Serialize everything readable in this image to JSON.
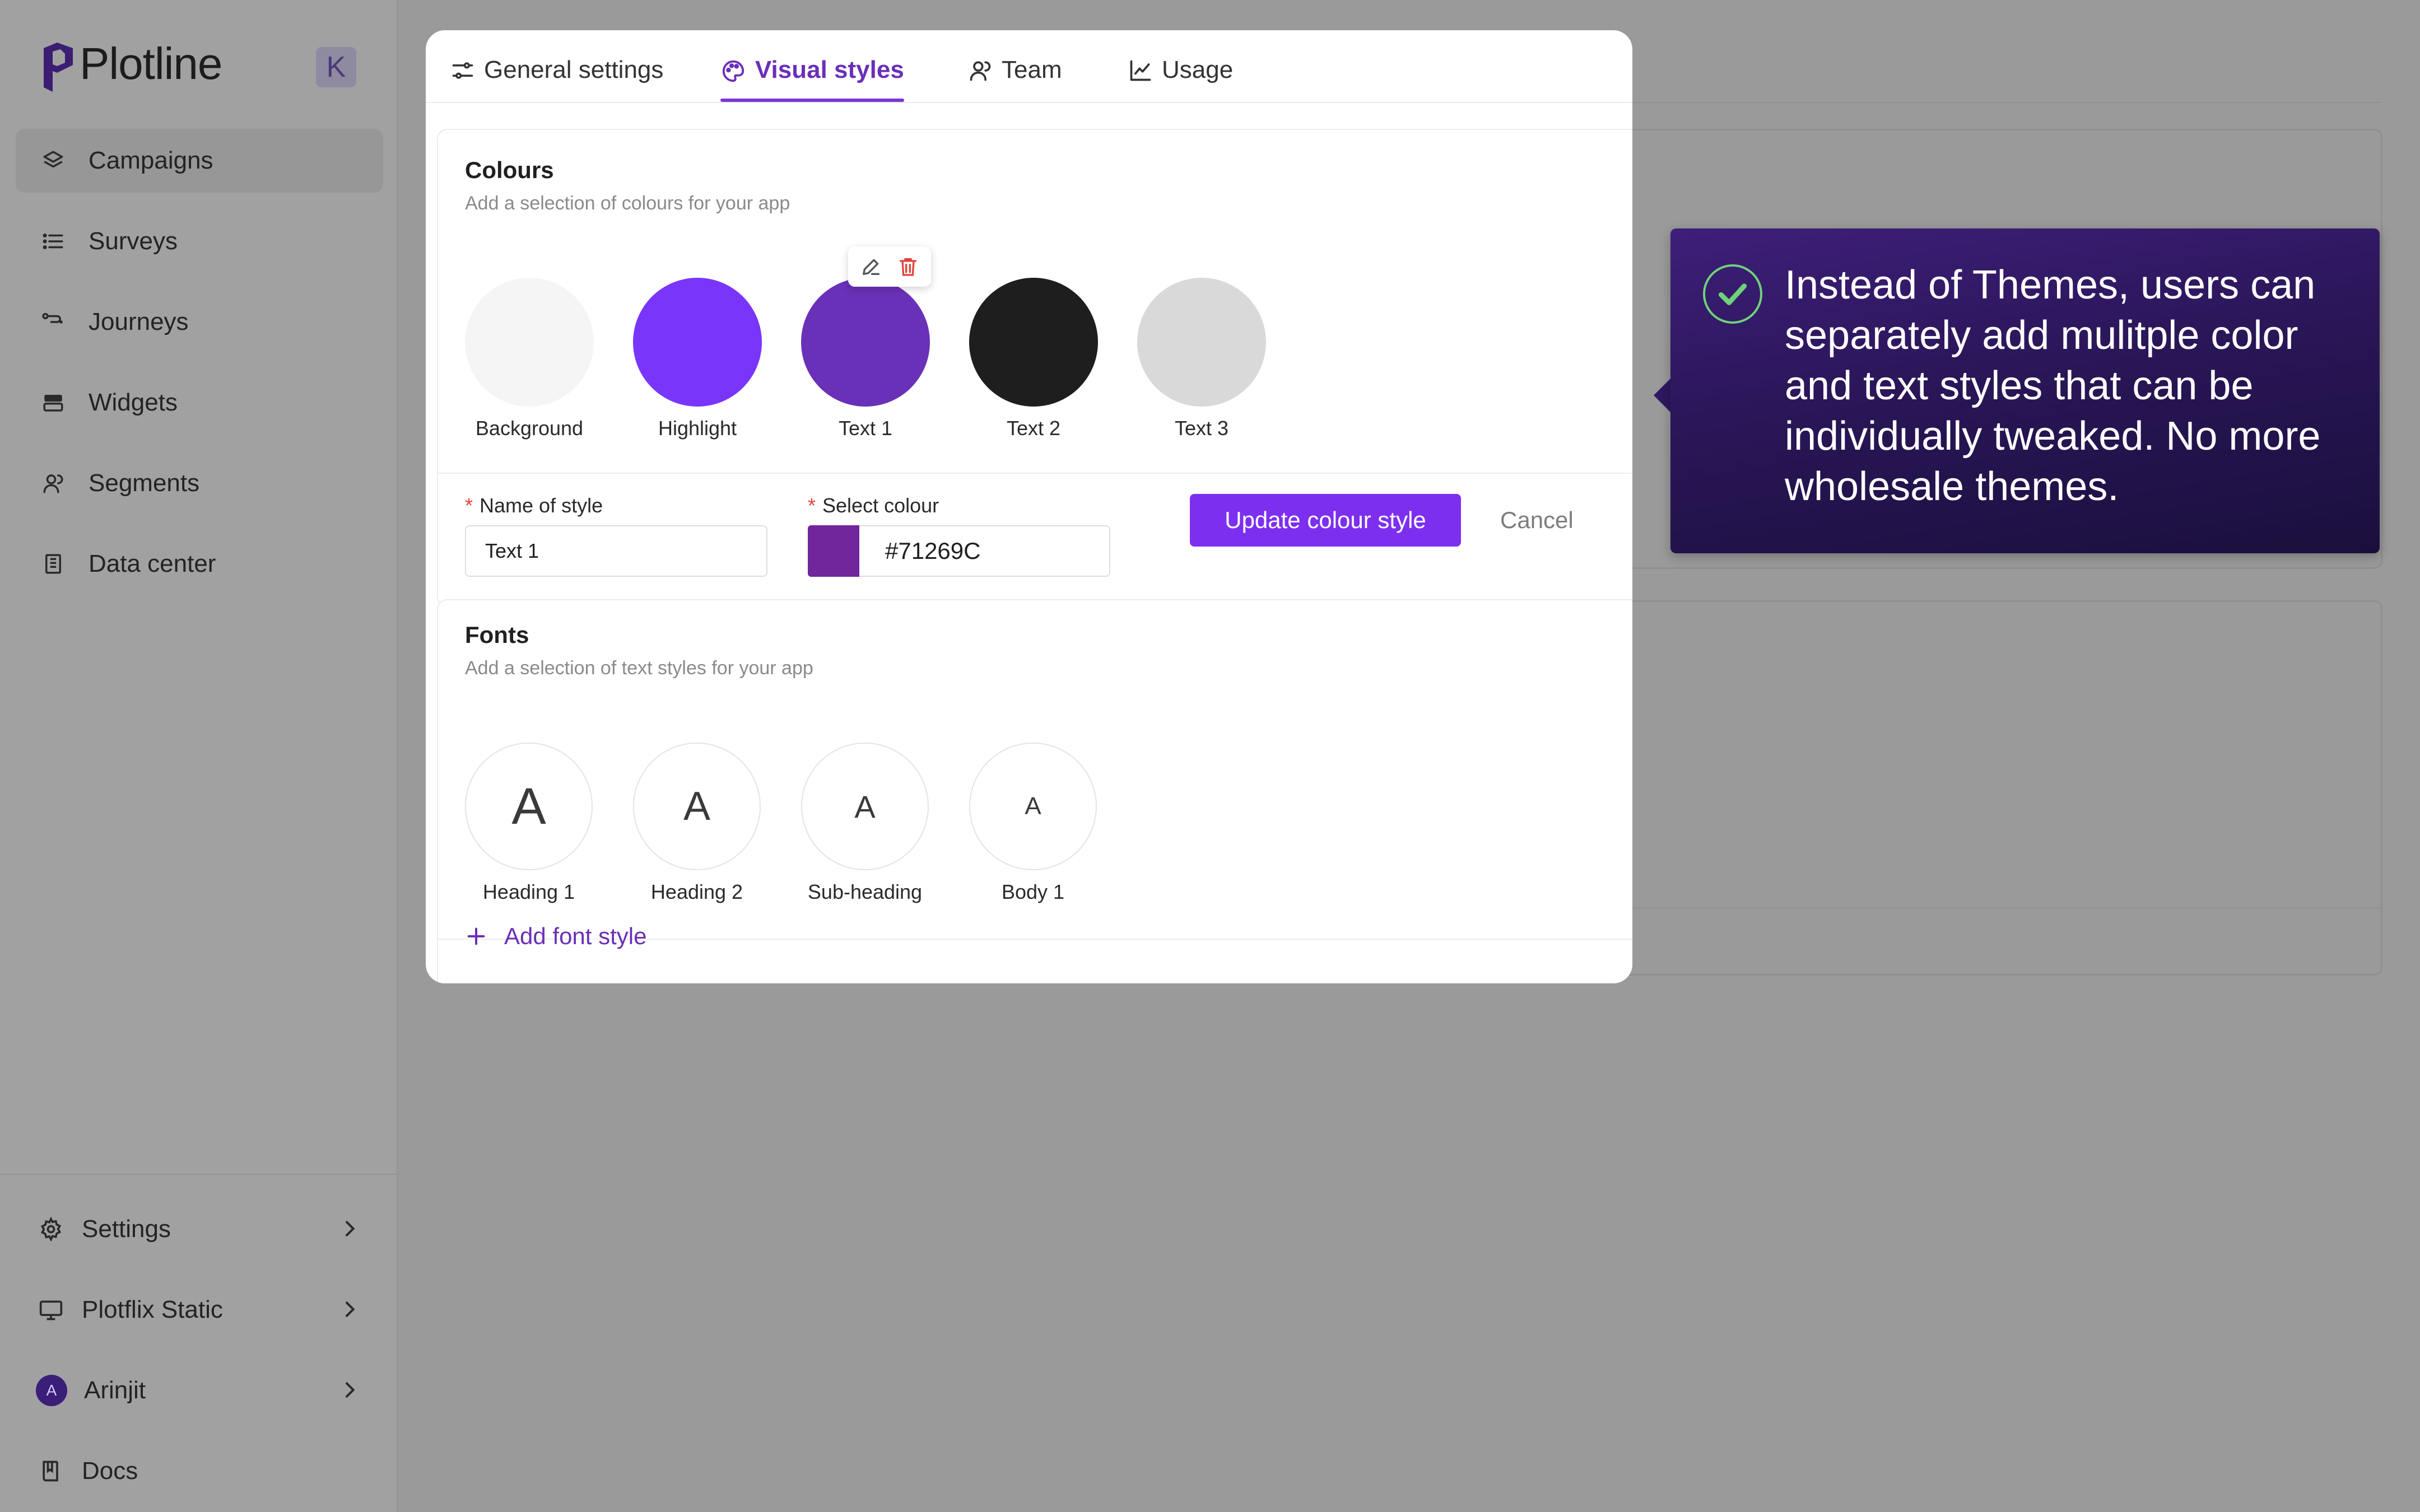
{
  "app": {
    "name": "Plotline",
    "collapse_key": "K"
  },
  "sidebar": {
    "items": [
      {
        "label": "Campaigns",
        "icon": "layers-icon",
        "active": true
      },
      {
        "label": "Surveys",
        "icon": "list-icon",
        "active": false
      },
      {
        "label": "Journeys",
        "icon": "route-icon",
        "active": false
      },
      {
        "label": "Widgets",
        "icon": "widget-icon",
        "active": false
      },
      {
        "label": "Segments",
        "icon": "users-icon",
        "active": false
      },
      {
        "label": "Data center",
        "icon": "building-icon",
        "active": false
      }
    ],
    "bottom": [
      {
        "label": "Settings",
        "icon": "gear-icon"
      },
      {
        "label": "Plotflix Static",
        "icon": "monitor-icon"
      },
      {
        "label": "Arinjit",
        "icon": "avatar",
        "avatar_letter": "A"
      },
      {
        "label": "Docs",
        "icon": "book-icon"
      }
    ]
  },
  "modal": {
    "tabs": [
      {
        "label": "General settings",
        "icon": "sliders-icon",
        "active": false
      },
      {
        "label": "Visual styles",
        "icon": "palette-icon",
        "active": true
      },
      {
        "label": "Team",
        "icon": "team-icon",
        "active": false
      },
      {
        "label": "Usage",
        "icon": "chart-line-icon",
        "active": false
      }
    ],
    "colours": {
      "title": "Colours",
      "subtitle": "Add a selection of colours for your app",
      "swatches": [
        {
          "label": "Background",
          "color": "#f5f5f5"
        },
        {
          "label": "Highlight",
          "color": "#7a35fb"
        },
        {
          "label": "Text 1",
          "color": "#6931b7"
        },
        {
          "label": "Text 2",
          "color": "#1e1e1e"
        },
        {
          "label": "Text 3",
          "color": "#d9d9d9"
        }
      ],
      "form": {
        "name_label": "Name of style",
        "name_value": "Text 1",
        "colour_label": "Select colour",
        "colour_value": "#71269C",
        "colour_chip": "#71269C",
        "update_label": "Update colour style",
        "cancel_label": "Cancel"
      }
    },
    "fonts": {
      "title": "Fonts",
      "subtitle": "Add a selection of text styles for your app",
      "styles": [
        {
          "label": "Heading 1",
          "glyph": "A"
        },
        {
          "label": "Heading 2",
          "glyph": "A"
        },
        {
          "label": "Sub-heading",
          "glyph": "A"
        },
        {
          "label": "Body 1",
          "glyph": "A"
        }
      ],
      "add_label": "Add font style"
    }
  },
  "callout": {
    "text": "Instead of Themes, users can separately add mulitple color and text styles that can be individually tweaked. No more wholesale themes."
  },
  "colors": {
    "accent": "#7d2ff0",
    "accent_text": "#6a2fb8",
    "required": "#e0443c",
    "callout_bg": "#2a1658",
    "check": "#6fd17a"
  }
}
